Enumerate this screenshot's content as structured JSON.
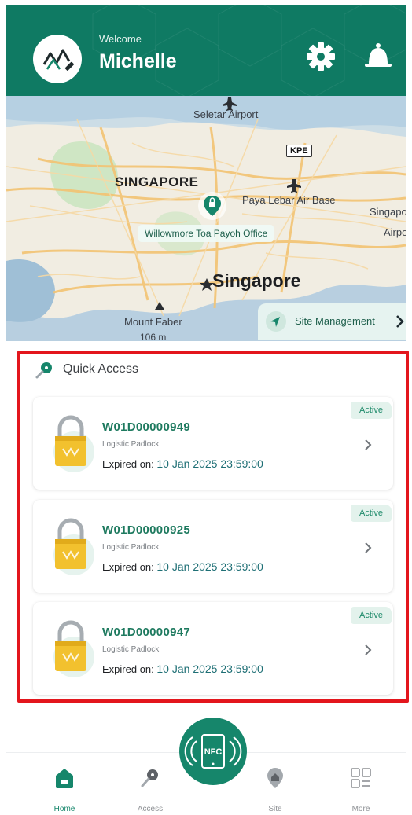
{
  "header": {
    "welcome": "Welcome",
    "username": "Michelle",
    "icons": [
      "avatar-logo",
      "gear-icon",
      "bell-icon"
    ],
    "accent_color": "#0f7a63"
  },
  "map": {
    "labels": {
      "seletar": "Seletar Airport",
      "kpe": "KPE",
      "singapore_caps": "SINGAPORE",
      "paya_lebar": "Paya Lebar Air Base",
      "singapo": "Singapo",
      "airpo": "Airpo",
      "office": "Willowmore Toa Payoh Office",
      "singapore": "Singapore",
      "mount_faber": "Mount Faber",
      "elevation": "106 m"
    },
    "site_management": "Site Management"
  },
  "quick_access": {
    "title": "Quick Access",
    "items": [
      {
        "id": "W01D00000949",
        "type": "Logistic Padlock",
        "expired_label": "Expired on:",
        "expired_value": "10 Jan 2025 23:59:00",
        "status": "Active"
      },
      {
        "id": "W01D00000925",
        "type": "Logistic Padlock",
        "expired_label": "Expired on:",
        "expired_value": "10 Jan 2025 23:59:00",
        "status": "Active"
      },
      {
        "id": "W01D00000947",
        "type": "Logistic Padlock",
        "expired_label": "Expired on:",
        "expired_value": "10 Jan 2025 23:59:00",
        "status": "Active"
      }
    ]
  },
  "nav": {
    "nfc": "NFC",
    "items": [
      {
        "label": "Home",
        "icon": "home-icon",
        "active": true
      },
      {
        "label": "Access",
        "icon": "key-icon",
        "active": false
      },
      {
        "label": "Site",
        "icon": "location-pin-icon",
        "active": false
      },
      {
        "label": "More",
        "icon": "grid-icon",
        "active": false
      }
    ]
  }
}
